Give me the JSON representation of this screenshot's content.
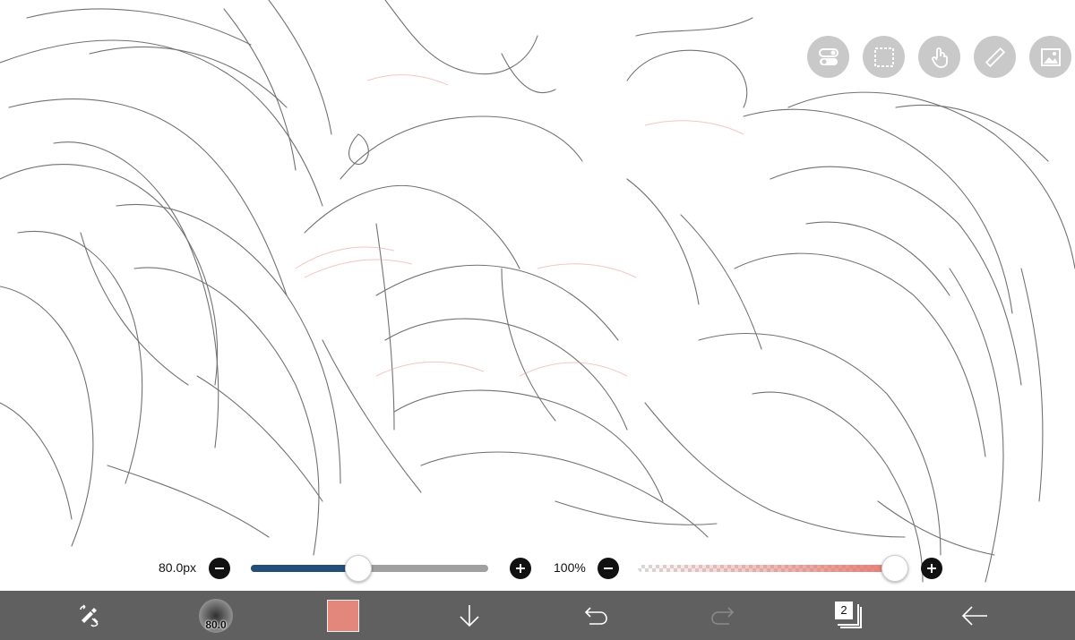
{
  "canvas": {
    "description_icon": "sketch-canvas"
  },
  "top_tools": [
    {
      "name": "toggle-icon"
    },
    {
      "name": "selection-icon"
    },
    {
      "name": "hand-icon"
    },
    {
      "name": "ruler-icon"
    },
    {
      "name": "image-icon"
    }
  ],
  "brush_size": {
    "label": "80.0px",
    "level": 0.45
  },
  "opacity": {
    "label": "100%",
    "level": 0.96
  },
  "toolbar": {
    "brush_size_preview": "80.0",
    "color": "#e3877d",
    "layers_count": "2"
  },
  "colors": {
    "toolbar_bg": "#606060",
    "size_fill": "#244e7a",
    "tool_button_bg": "#c9c9c9",
    "accent_color": "#e3877d"
  }
}
